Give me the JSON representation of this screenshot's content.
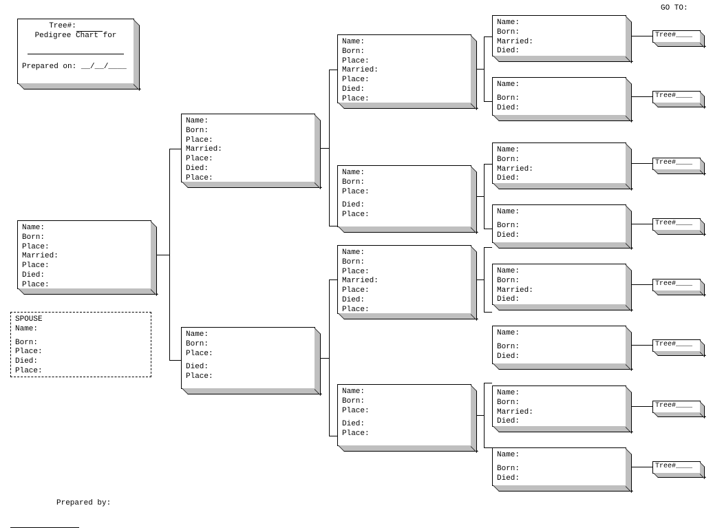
{
  "labels": {
    "name": "Name:",
    "born": "Born:",
    "place": "Place:",
    "married": "Married:",
    "died": "Died:",
    "spouse": "SPOUSE",
    "tree_num": "Tree#:",
    "tree_ref": "Tree#____",
    "pedigree_for": "Pedigree Chart for",
    "prepared_on": "Prepared on:  __/__/____",
    "prepared_by": "Prepared by:",
    "go_to": "GO TO:"
  }
}
